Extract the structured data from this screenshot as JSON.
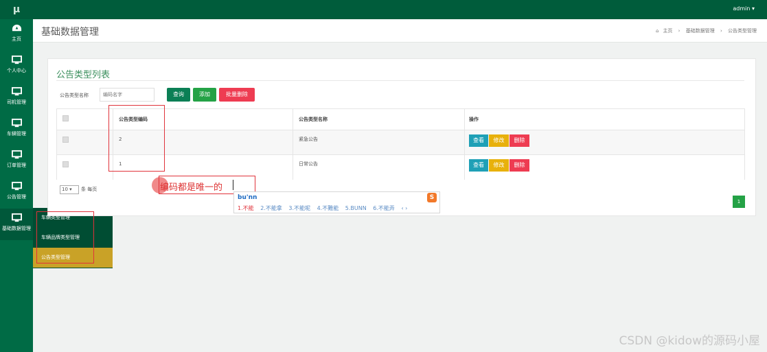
{
  "app": {
    "logo": "μ",
    "user": "admin ▾"
  },
  "sidebar": {
    "items": [
      {
        "label": "主页",
        "icon": "dashboard-icon"
      },
      {
        "label": "个人中心",
        "icon": "monitor-icon"
      },
      {
        "label": "司机管理",
        "icon": "monitor-icon"
      },
      {
        "label": "车辆管理",
        "icon": "monitor-icon"
      },
      {
        "label": "订单管理",
        "icon": "monitor-icon"
      },
      {
        "label": "公告管理",
        "icon": "monitor-icon"
      },
      {
        "label": "基础数据管理",
        "icon": "monitor-icon"
      }
    ],
    "submenu": [
      "车辆类型管理",
      "车辆品牌类型管理",
      "公告类型管理"
    ]
  },
  "header": {
    "title": "基础数据管理",
    "breadcrumb": [
      "主页",
      "基础数据管理",
      "公告类型管理"
    ]
  },
  "list": {
    "title": "公告类型列表",
    "search_label": "公告类型名称",
    "search_placeholder": "编码名字",
    "buttons": {
      "query": "查询",
      "add": "添加",
      "bulk_delete": "批量删除"
    },
    "columns": [
      "公告类型编码",
      "公告类型名称",
      "操作"
    ],
    "rows": [
      {
        "code": "2",
        "name": "紧急公告"
      },
      {
        "code": "1",
        "name": "日常公告"
      }
    ],
    "actions": {
      "view": "查看",
      "edit": "修改",
      "delete": "删除"
    },
    "page_size": "10 ▾",
    "page_size_suffix": "条 每页",
    "current_page": "1"
  },
  "annotation": {
    "text": "编码都是唯一的"
  },
  "ime": {
    "composition": "bu'nn",
    "logo": "S",
    "candidates": [
      "1.不能",
      "2.不能拿",
      "3.不能呢",
      "4.不難能",
      "5.BUNN",
      "6.不能弄",
      "‹ ›"
    ]
  },
  "watermark": "CSDN @kidow的源码小屋",
  "colors": {
    "topbar": "#005c3b",
    "sidebar": "#006b45",
    "accent_green": "#24a246",
    "danger": "#ee3c52",
    "warning": "#e8b10c",
    "info": "#1fa0b6",
    "submenu_active": "#c9a227"
  }
}
